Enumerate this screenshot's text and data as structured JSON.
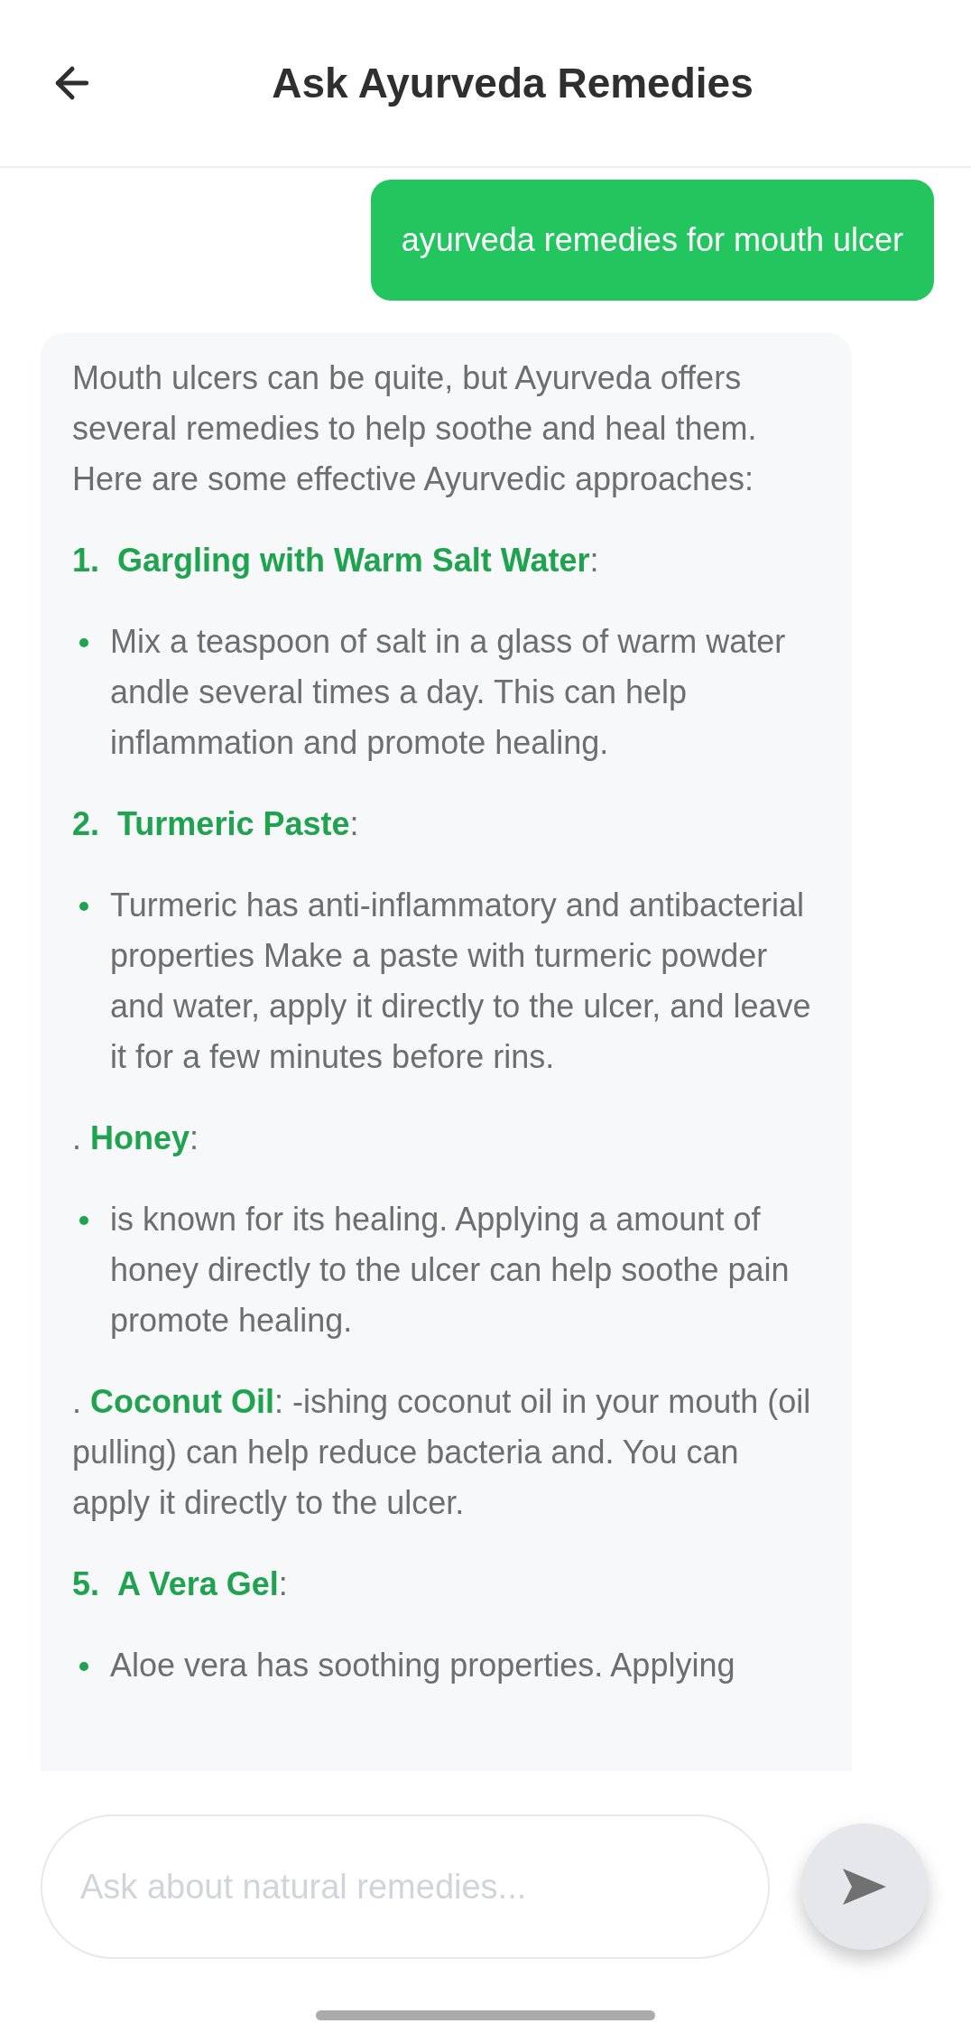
{
  "header": {
    "title": "Ask Ayurveda Remedies"
  },
  "messages": [
    {
      "kind": "user",
      "text": "ayurveda remedies for mouth ulcer"
    },
    {
      "kind": "bot",
      "blocks": [
        {
          "kind": "text",
          "text": "Mouth ulcers can be quite, but Ayurveda offers several remedies to help soothe and heal them. Here are some effective Ayurvedic approaches:"
        },
        {
          "kind": "heading",
          "number": "1.",
          "title": "Gargling with Warm Salt Water",
          "suffix": ":"
        },
        {
          "kind": "bullet",
          "text": "Mix a teaspoon of salt in a glass of warm water andle several times a day. This can help inflammation and promote healing."
        },
        {
          "kind": "heading",
          "number": "2.",
          "title": "Turmeric Paste",
          "suffix": ":"
        },
        {
          "kind": "bullet",
          "text": "Turmeric has anti-inflammatory and antibacterial properties Make a paste with turmeric powder and water, apply it directly to the ulcer, and leave it for a few minutes before rins."
        },
        {
          "kind": "dotted",
          "prefix": ".",
          "title": "Honey",
          "suffix": ":"
        },
        {
          "kind": "bullet",
          "text": "is known for its healing. Applying a amount of honey directly to the ulcer can help soothe pain promote healing."
        },
        {
          "kind": "dotted",
          "prefix": ".",
          "title": "Coconut Oil",
          "suffix": ": -ishing coconut oil in your mouth (oil pulling) can help reduce bacteria and. You can apply it directly to the ulcer."
        },
        {
          "kind": "heading",
          "number": "5.",
          "title": "A Vera Gel",
          "suffix": ":"
        },
        {
          "kind": "bullet",
          "text": "Aloe vera has soothing properties. Applying"
        }
      ]
    }
  ],
  "composer": {
    "placeholder": "Ask about natural remedies..."
  }
}
